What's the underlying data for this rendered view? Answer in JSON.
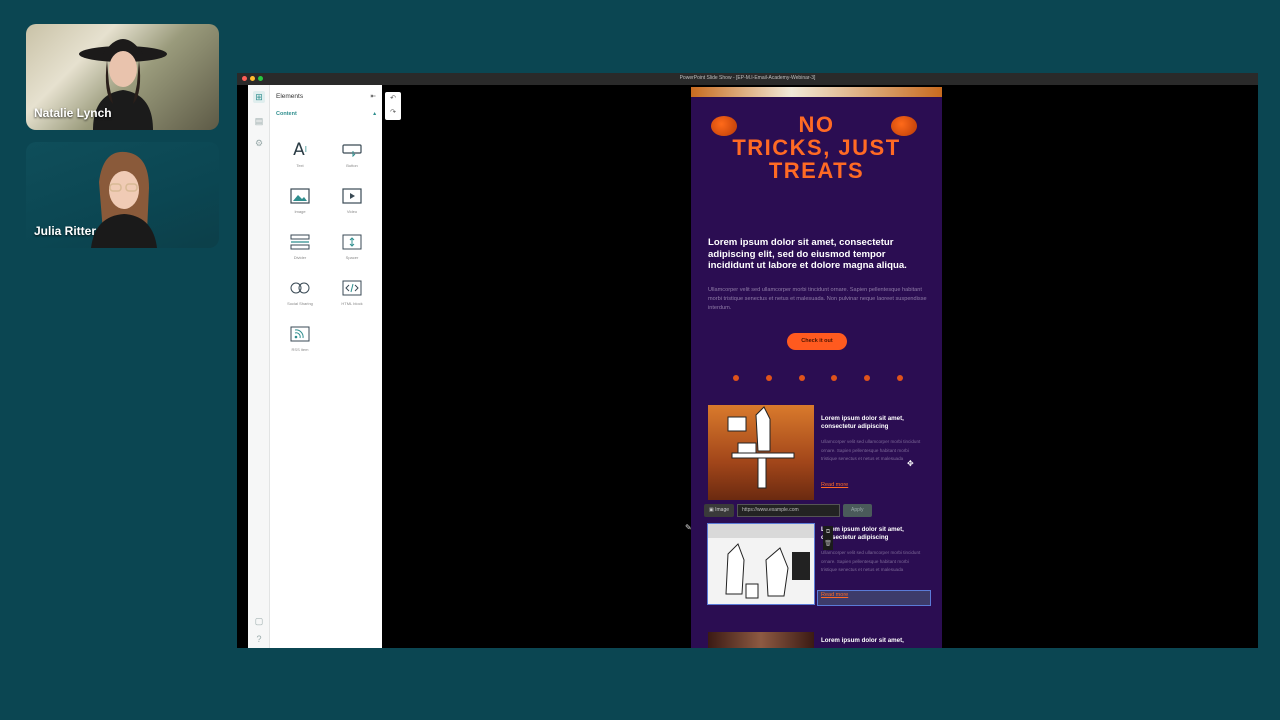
{
  "participants": [
    {
      "name": "Natalie Lynch"
    },
    {
      "name": "Julia Ritter"
    }
  ],
  "window": {
    "title": "PowerPoint Slide Show - [EP-M.I-Email-Academy-Webinar-3]"
  },
  "editor": {
    "panel_title": "Elements",
    "section_label": "Content",
    "elements": [
      {
        "label": "Text",
        "icon": "text-icon"
      },
      {
        "label": "Button",
        "icon": "button-icon"
      },
      {
        "label": "Image",
        "icon": "image-icon"
      },
      {
        "label": "Video",
        "icon": "video-icon"
      },
      {
        "label": "Divider",
        "icon": "divider-icon"
      },
      {
        "label": "Spacer",
        "icon": "spacer-icon"
      },
      {
        "label": "Social Sharing",
        "icon": "social-sharing-icon"
      },
      {
        "label": "HTML block",
        "icon": "html-block-icon"
      },
      {
        "label": "RSS item",
        "icon": "rss-icon"
      }
    ]
  },
  "email": {
    "headline_lines": [
      "NO",
      "TRICKS, JUST",
      "TREATS"
    ],
    "heading": "Lorem ipsum dolor sit amet, consectetur adipiscing elit, sed do eiusmod tempor incididunt ut labore et dolore magna aliqua.",
    "body": "Ullamcorper velit sed ullamcorper morbi tincidunt ornare. Sapien pellentesque habitant morbi tristique senectus et netus et malesuada. Non pulvinar neque laoreet suspendisse interdum.",
    "cta": "Check it out",
    "cards": [
      {
        "title": "Lorem ipsum dolor sit amet, consectetur adipiscing",
        "body": "Ullamcorper velit sed ullamcorper morbi tincidunt ornare. Sapien pellentesque habitant morbi tristique senectus et netus et malesuada",
        "link": "Read more"
      },
      {
        "title": "Lorem ipsum dolor sit amet, consectetur adipiscing",
        "body": "Ullamcorper velit sed ullamcorper morbi tincidunt ornare. Sapien pellentesque habitant morbi tristique senectus et netus et malesuada",
        "link": "Read more"
      },
      {
        "title": "Lorem ipsum dolor sit amet,"
      }
    ],
    "image_toolbar": {
      "type_label": "Image",
      "url_value": "https://www.example.com",
      "apply_label": "Apply"
    }
  },
  "colors": {
    "page_bg": "#0b4652",
    "email_bg": "#2b0d52",
    "accent_orange": "#ff6a24",
    "editor_accent": "#2f8e8e"
  }
}
